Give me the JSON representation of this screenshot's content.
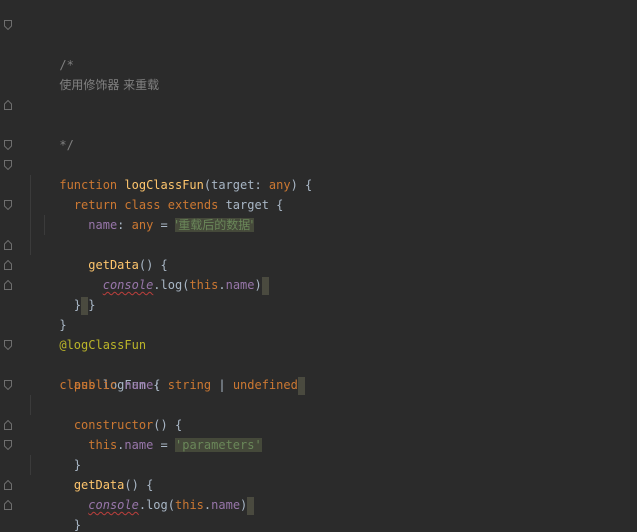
{
  "lines": {
    "l1": "/*",
    "l2": "使用修饰器 来重载",
    "l3": "*/",
    "l4": {
      "kw": "function",
      "name": "logClassFun",
      "open": "(",
      "param": "target",
      "colon": ": ",
      "type": "any",
      "close": ") {"
    },
    "l5": {
      "ret": "return",
      "cls": "class",
      "ext": "extends",
      "target": "target",
      "brace": " {"
    },
    "l6": {
      "prop": "name",
      "colon": ": ",
      "type": "any",
      "eq": " = ",
      "str": "'重载后的数据'"
    },
    "l7": {
      "method": "getData",
      "rest": "() {"
    },
    "l8": {
      "console": "console",
      "dot": ".",
      "log": "log",
      "open": "(",
      "this": "this",
      "dot2": ".",
      "prop": "name",
      "close": ")"
    },
    "l9": "}",
    "l10": "}",
    "l11": "}",
    "l12": "@logClassFun",
    "l13": {
      "cls": "class",
      "name": "logFun",
      "brace": " {"
    },
    "l14": {
      "mod": "public",
      "prop": "name",
      "colon": ": ",
      "t1": "string",
      "pipe": " | ",
      "t2": "undefined"
    },
    "l15": {
      "kw": "constructor",
      "rest": "() {"
    },
    "l16": {
      "this": "this",
      "dot": ".",
      "prop": "name",
      "eq": " = ",
      "str": "'parameters'"
    },
    "l17": "}",
    "l18": {
      "method": "getData",
      "rest": "() {"
    },
    "l19": {
      "console": "console",
      "dot": ".",
      "log": "log",
      "open": "(",
      "this": "this",
      "dot2": ".",
      "prop": "name",
      "close": ")"
    },
    "l20": "}",
    "l21": "}"
  },
  "colors": {
    "background": "#2b2b2b",
    "keyword": "#cc7832",
    "function_name": "#ffc66d",
    "property": "#9876aa",
    "string": "#6a8759",
    "comment": "#808080",
    "decorator": "#bbb529",
    "default_text": "#a9b7c6"
  }
}
